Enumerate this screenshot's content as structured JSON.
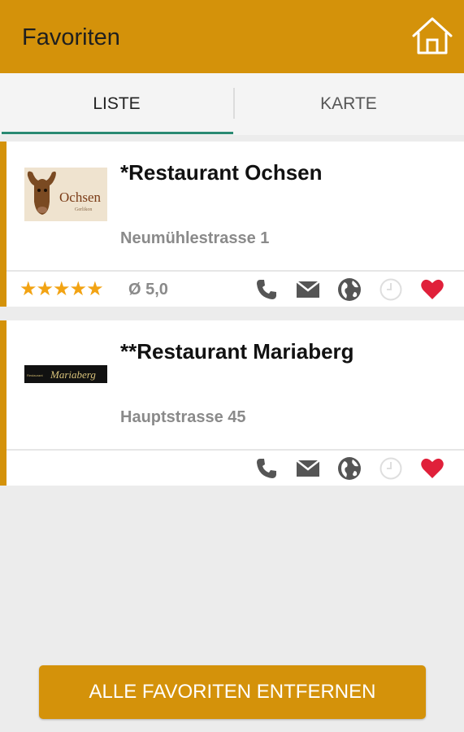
{
  "header": {
    "title": "Favoriten"
  },
  "tabs": [
    {
      "label": "LISTE",
      "active": true
    },
    {
      "label": "KARTE",
      "active": false
    }
  ],
  "favorites": [
    {
      "name": "*Restaurant Ochsen",
      "address": "Neumühlestrasse 1",
      "stars": "★★★★★",
      "rating": "Ø 5,0",
      "logo_text": "Ochsen",
      "logo_subtext": "Gerlikon",
      "favorite": true
    },
    {
      "name": "**Restaurant Mariaberg",
      "address": "Hauptstrasse 45",
      "logo_prefix": "Restaurant",
      "logo_text": "Mariaberg",
      "favorite": true
    }
  ],
  "actions": {
    "remove_all_label": "ALLE FAVORITEN ENTFERNEN"
  },
  "icons": [
    "home-icon",
    "phone-icon",
    "mail-icon",
    "globe-icon",
    "clock-icon",
    "heart-icon"
  ],
  "colors": {
    "accent": "#d4920a",
    "tab_indicator": "#2a8a73",
    "heart": "#e0203a",
    "star": "#f2a313"
  }
}
